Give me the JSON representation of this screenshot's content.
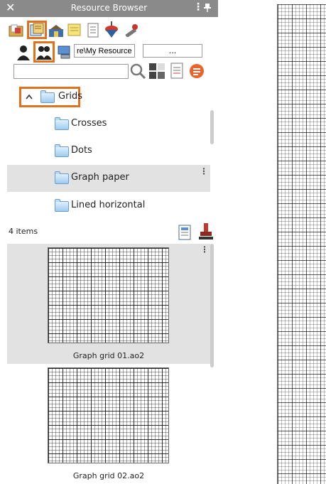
{
  "window": {
    "title": "Resource Browser",
    "close_symbol": "✕",
    "menu_symbol": "⋮"
  },
  "toolbar_icons": [
    "folder-files-icon",
    "documents-icon",
    "books-icon",
    "sticky-note-icon",
    "page-icon",
    "spinning-top-icon",
    "tools-icon"
  ],
  "scope_icons": [
    "single-user-icon",
    "multi-user-icon",
    "network-icon"
  ],
  "path": {
    "value": "re\\My Resources",
    "browse_label": "..."
  },
  "search": {
    "placeholder": "",
    "value": ""
  },
  "tree": {
    "root": {
      "label": "Grids",
      "expanded": true
    },
    "items": [
      {
        "label": "Crosses",
        "selected": false
      },
      {
        "label": "Dots",
        "selected": false
      },
      {
        "label": "Graph paper",
        "selected": true
      },
      {
        "label": "Lined horizontal",
        "selected": false
      }
    ]
  },
  "results": {
    "count_label": "4 items",
    "thumbnails": [
      {
        "caption": "Graph grid 01.ao2"
      },
      {
        "caption": "Graph grid 02.ao2"
      }
    ]
  },
  "colors": {
    "highlight": "#e2711d",
    "titlebar": "#8a8a8a",
    "selection": "#e2e2e2"
  }
}
